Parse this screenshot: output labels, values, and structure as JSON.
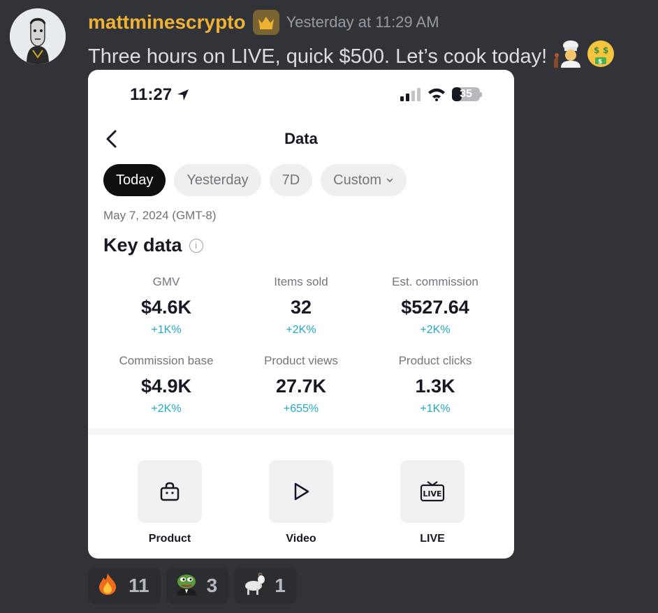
{
  "post": {
    "username": "mattminescrypto",
    "badge_icon": "crown-icon",
    "timestamp": "Yesterday at 11:29 AM",
    "message": "Three hours on LIVE, quick $500. Let’s cook today!",
    "message_emojis": [
      "cook-emoji",
      "money-mouth-emoji"
    ]
  },
  "screenshot": {
    "status": {
      "time": "11:27",
      "battery": "35",
      "battery_level": 0.35
    },
    "nav": {
      "title": "Data"
    },
    "tabs": [
      {
        "label": "Today",
        "active": true
      },
      {
        "label": "Yesterday"
      },
      {
        "label": "7D"
      },
      {
        "label": "Custom"
      }
    ],
    "date": "May 7, 2024 (GMT-8)",
    "key_data_title": "Key data",
    "metrics": [
      {
        "label": "GMV",
        "value": "$4.6K",
        "change": "+1K%"
      },
      {
        "label": "Items sold",
        "value": "32",
        "change": "+2K%"
      },
      {
        "label": "Est. commission",
        "value": "$527.64",
        "change": "+2K%"
      },
      {
        "label": "Commission base",
        "value": "$4.9K",
        "change": "+2K%"
      },
      {
        "label": "Product views",
        "value": "27.7K",
        "change": "+655%"
      },
      {
        "label": "Product clicks",
        "value": "1.3K",
        "change": "+1K%"
      }
    ],
    "tiles": [
      {
        "label": "Product",
        "icon": "shopping-bag-icon"
      },
      {
        "label": "Video",
        "icon": "play-icon"
      },
      {
        "label": "LIVE",
        "icon": "live-tv-icon",
        "icon_text": "LIVE"
      }
    ]
  },
  "reactions": [
    {
      "emoji": "fire-emoji",
      "count": "11"
    },
    {
      "emoji": "pepe-emoji",
      "count": "3"
    },
    {
      "emoji": "goat-emoji",
      "count": "1"
    }
  ],
  "colors": {
    "username": "#f0b232",
    "background": "#313338",
    "accent_change": "#20a9c6"
  }
}
